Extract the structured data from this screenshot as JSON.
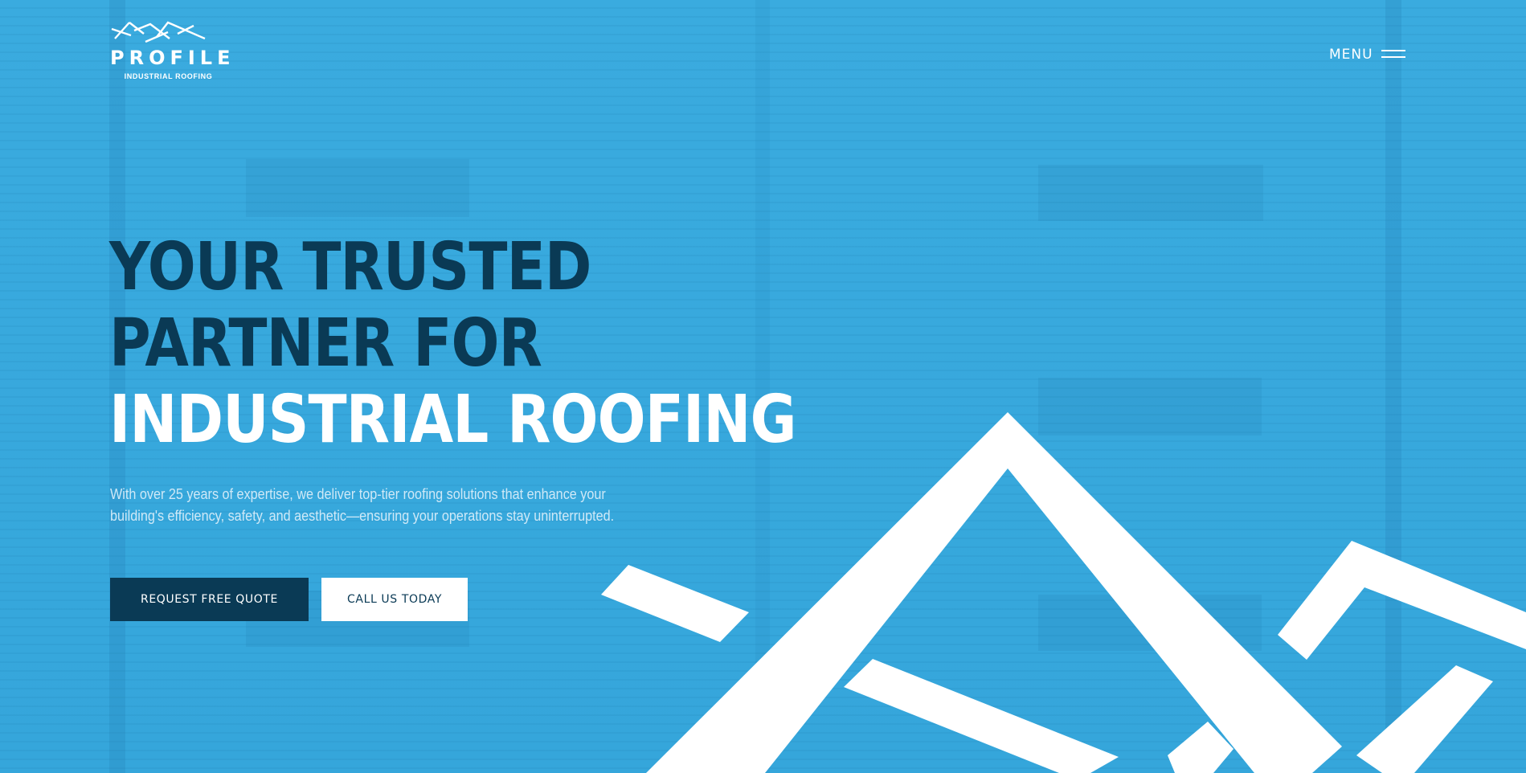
{
  "brand": {
    "name": "PROFILE",
    "tagline": "INDUSTRIAL ROOFING",
    "logo_icon": "mountain-roof-icon"
  },
  "nav": {
    "menu_label": "MENU",
    "menu_icon": "hamburger-icon"
  },
  "hero": {
    "headline_line1": "YOUR TRUSTED",
    "headline_line2": "PARTNER FOR",
    "headline_line3": "INDUSTRIAL ROOFING",
    "description": "With over 25 years of expertise, we deliver top-tier roofing solutions that enhance your building's efficiency, safety, and aesthetic—ensuring your operations stay uninterrupted.",
    "primary_button": "REQUEST FREE QUOTE",
    "secondary_button": "CALL US TODAY"
  },
  "colors": {
    "background": "#38a9de",
    "navy": "#0a3a55",
    "white": "#ffffff"
  }
}
